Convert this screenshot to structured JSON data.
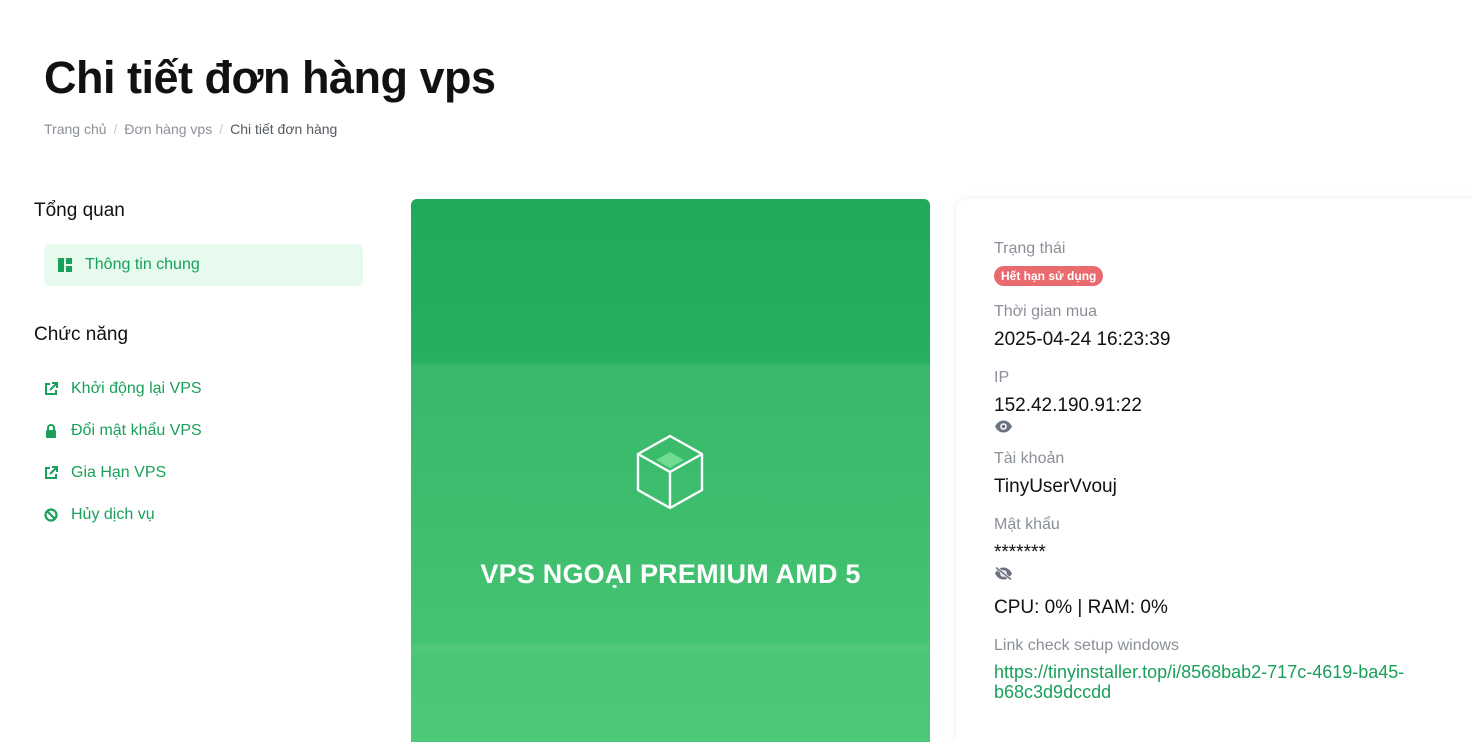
{
  "page": {
    "title": "Chi tiết đơn hàng vps",
    "breadcrumb": [
      "Trang chủ",
      "Đơn hàng vps",
      "Chi tiết đơn hàng"
    ]
  },
  "sidebar": {
    "overview_title": "Tổng quan",
    "overview_item": "Thông tin chung",
    "functions_title": "Chức năng",
    "functions": [
      {
        "label": "Khởi động lại VPS",
        "icon": "external-link-icon"
      },
      {
        "label": "Đổi mật khẩu VPS",
        "icon": "lock-icon"
      },
      {
        "label": "Gia Hạn VPS",
        "icon": "external-link-icon"
      },
      {
        "label": "Hủy dịch vụ",
        "icon": "ban-icon"
      }
    ]
  },
  "banner": {
    "product_name": "VPS NGOẠI PREMIUM AMD 5",
    "icon": "cube-icon"
  },
  "details": {
    "status_label": "Trạng thái",
    "status_value": "Hết hạn sử dụng",
    "purchase_time_label": "Thời gian mua",
    "purchase_time_value": "2025-04-24 16:23:39",
    "ip_label": "IP",
    "ip_value": "152.42.190.91:22",
    "account_label": "Tài khoản",
    "account_value": "TinyUserVvouj",
    "password_label": "Mật khẩu",
    "password_value": "*******",
    "usage_value": "CPU: 0% | RAM: 0%",
    "link_label": "Link check setup windows",
    "link_value": "https://tinyinstaller.top/i/8568bab2-717c-4619-ba45-b68c3d9dccdd"
  },
  "colors": {
    "accent": "#19a05a",
    "status_expired": "#e96a6f",
    "active_bg": "#e6faee"
  }
}
